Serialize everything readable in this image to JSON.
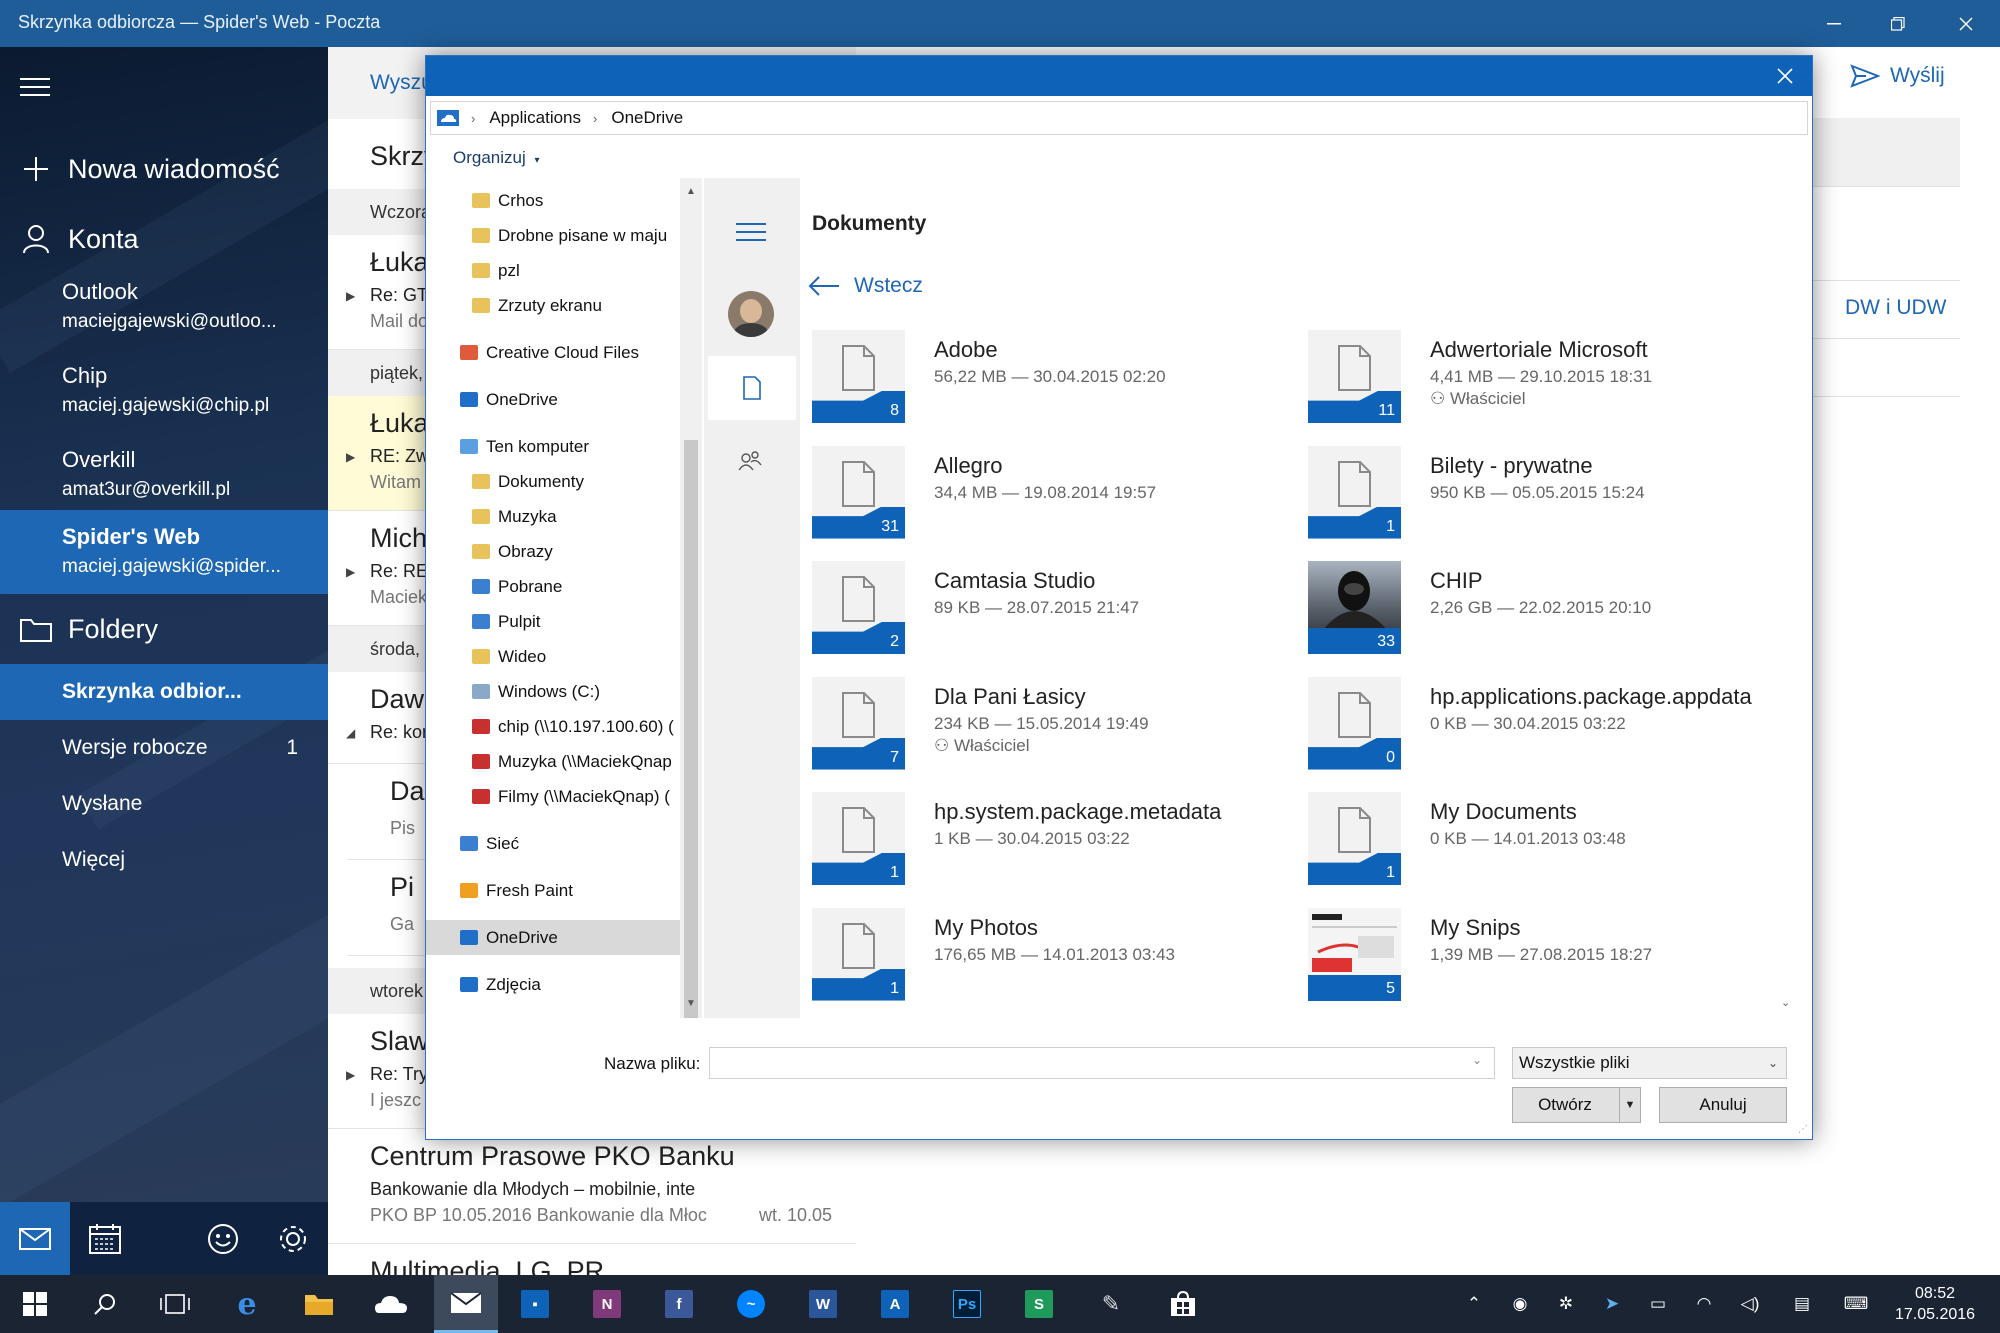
{
  "window": {
    "title": "Skrzynka odbiorcza — Spider's Web - Poczta"
  },
  "nav": {
    "new_message": "Nowa wiadomość",
    "accounts_label": "Konta",
    "accounts": [
      {
        "name": "Outlook",
        "email": "maciejgajewski@outloo..."
      },
      {
        "name": "Chip",
        "email": "maciej.gajewski@chip.pl"
      },
      {
        "name": "Overkill",
        "email": "amat3ur@overkill.pl"
      },
      {
        "name": "Spider's Web",
        "email": "maciej.gajewski@spider..."
      }
    ],
    "folders_label": "Foldery",
    "folders": [
      {
        "name": "Skrzynka odbior...",
        "count": ""
      },
      {
        "name": "Wersje robocze",
        "count": "1"
      },
      {
        "name": "Wysłane",
        "count": ""
      },
      {
        "name": "Więcej",
        "count": ""
      }
    ]
  },
  "message_list": {
    "search_placeholder": "Wyszu",
    "heading": "Skrzy",
    "groups": [
      {
        "date": "Wczora"
      },
      {
        "date": "piątek,"
      },
      {
        "date": "środa,"
      },
      {
        "date": "wtorek"
      }
    ],
    "items": [
      {
        "sender": "Łukas",
        "subject": "Re: GT",
        "preview": "Mail do",
        "date": ""
      },
      {
        "sender": "Łukas",
        "subject": "RE: Zw",
        "preview": "Witam",
        "date": ""
      },
      {
        "sender": "Mich",
        "subject": "Re: RE:",
        "preview": "Maciek",
        "date": ""
      },
      {
        "sender": "Dawi",
        "subject": "Re: kor",
        "preview": "",
        "date": ""
      },
      {
        "sender": "Da",
        "subject": "",
        "preview": "Pis",
        "date": ""
      },
      {
        "sender": "Pi",
        "subject": "",
        "preview": "Ga",
        "date": ""
      },
      {
        "sender": "Slaw",
        "subject": "Re: Try",
        "preview": "I jeszc",
        "date": ""
      },
      {
        "sender": "Centrum Prasowe PKO Banku",
        "subject": "Bankowanie dla Młodych – mobilnie, inte",
        "preview": "PKO BP 10.05.2016 Bankowanie dla Młoc",
        "date": "wt. 10.05"
      },
      {
        "sender": "Multimedia_LG_PR",
        "subject": "",
        "preview": "",
        "date": ""
      }
    ]
  },
  "compose": {
    "send_label": "Wyślij",
    "cc_label": "DW i UDW"
  },
  "dialog": {
    "breadcrumb": [
      "Applications",
      "OneDrive"
    ],
    "organize_label": "Organizuj",
    "tree": [
      {
        "label": "Crhos",
        "indent": 1,
        "color": "#e8c25a"
      },
      {
        "label": "Drobne pisane w maju",
        "indent": 1,
        "color": "#e8c25a"
      },
      {
        "label": "pzl",
        "indent": 1,
        "color": "#e8c25a"
      },
      {
        "label": "Zrzuty ekranu",
        "indent": 1,
        "color": "#e8c25a"
      },
      {
        "label": "Creative Cloud Files",
        "indent": 0,
        "color": "#e05a3c"
      },
      {
        "label": "OneDrive",
        "indent": 0,
        "color": "#1f6fc8"
      },
      {
        "label": "Ten komputer",
        "indent": 0,
        "color": "#5aa0e0"
      },
      {
        "label": "Dokumenty",
        "indent": 1,
        "color": "#e8c25a"
      },
      {
        "label": "Muzyka",
        "indent": 1,
        "color": "#e8c25a"
      },
      {
        "label": "Obrazy",
        "indent": 1,
        "color": "#e8c25a"
      },
      {
        "label": "Pobrane",
        "indent": 1,
        "color": "#3a7fd0"
      },
      {
        "label": "Pulpit",
        "indent": 1,
        "color": "#3a7fd0"
      },
      {
        "label": "Wideo",
        "indent": 1,
        "color": "#e8c25a"
      },
      {
        "label": "Windows (C:)",
        "indent": 1,
        "color": "#8aa8c8"
      },
      {
        "label": "chip (\\\\10.197.100.60) (",
        "indent": 1,
        "color": "#c83030"
      },
      {
        "label": "Muzyka (\\\\MaciekQnap",
        "indent": 1,
        "color": "#c83030"
      },
      {
        "label": "Filmy (\\\\MaciekQnap) (",
        "indent": 1,
        "color": "#c83030"
      },
      {
        "label": "Sieć",
        "indent": 0,
        "color": "#3a7fd0"
      },
      {
        "label": "Fresh Paint",
        "indent": 0,
        "color": "#f0a020"
      },
      {
        "label": "OneDrive",
        "indent": 0,
        "color": "#1f6fc8"
      },
      {
        "label": "Zdjęcia",
        "indent": 0,
        "color": "#1f6fc8"
      }
    ],
    "content_title": "Dokumenty",
    "back_label": "Wstecz",
    "files": [
      {
        "name": "Adobe",
        "meta": "56,22 MB — 30.04.2015 02:20",
        "owner": "",
        "count": "8",
        "thumb": "doc"
      },
      {
        "name": "Adwertoriale Microsoft",
        "meta": "4,41 MB — 29.10.2015 18:31",
        "owner": "Właściciel",
        "count": "11",
        "thumb": "doc"
      },
      {
        "name": "Allegro",
        "meta": "34,4 MB — 19.08.2014 19:57",
        "owner": "",
        "count": "31",
        "thumb": "doc"
      },
      {
        "name": "Bilety - prywatne",
        "meta": "950 KB — 05.05.2015 15:24",
        "owner": "",
        "count": "1",
        "thumb": "doc"
      },
      {
        "name": "Camtasia Studio",
        "meta": "89 KB — 28.07.2015 21:47",
        "owner": "",
        "count": "2",
        "thumb": "doc"
      },
      {
        "name": "CHIP",
        "meta": "2,26 GB — 22.02.2015 20:10",
        "owner": "",
        "count": "33",
        "thumb": "photo-dark"
      },
      {
        "name": "Dla Pani Łasicy",
        "meta": "234 KB — 15.05.2014 19:49",
        "owner": "Właściciel",
        "count": "7",
        "thumb": "doc"
      },
      {
        "name": "hp.applications.package.appdata",
        "meta": "0 KB — 30.04.2015 03:22",
        "owner": "",
        "count": "0",
        "thumb": "doc"
      },
      {
        "name": "hp.system.package.metadata",
        "meta": "1 KB — 30.04.2015 03:22",
        "owner": "",
        "count": "1",
        "thumb": "doc"
      },
      {
        "name": "My Documents",
        "meta": "0 KB — 14.01.2013 03:48",
        "owner": "",
        "count": "1",
        "thumb": "doc"
      },
      {
        "name": "My Photos",
        "meta": "176,65 MB — 14.01.2013 03:43",
        "owner": "",
        "count": "1",
        "thumb": "doc"
      },
      {
        "name": "My Snips",
        "meta": "1,39 MB — 27.08.2015 18:27",
        "owner": "",
        "count": "5",
        "thumb": "photo-web"
      }
    ],
    "filename_label": "Nazwa pliku:",
    "filename_value": "",
    "filter_value": "Wszystkie pliki",
    "open_label": "Otwórz",
    "cancel_label": "Anuluj"
  },
  "taskbar": {
    "time": "08:52",
    "date": "17.05.2016"
  }
}
